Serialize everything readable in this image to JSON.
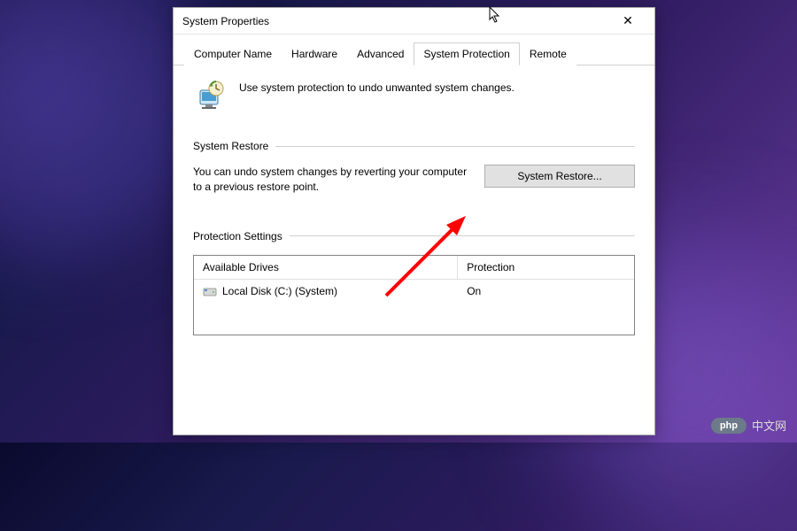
{
  "dialog": {
    "title": "System Properties",
    "close_label": "✕"
  },
  "tabs": {
    "items": [
      {
        "label": "Computer Name"
      },
      {
        "label": "Hardware"
      },
      {
        "label": "Advanced"
      },
      {
        "label": "System Protection"
      },
      {
        "label": "Remote"
      }
    ],
    "active_index": 3
  },
  "intro": {
    "text": "Use system protection to undo unwanted system changes."
  },
  "restore": {
    "section_label": "System Restore",
    "description": "You can undo system changes by reverting your computer to a previous restore point.",
    "button_label": "System Restore..."
  },
  "protection": {
    "section_label": "Protection Settings",
    "columns": {
      "drive": "Available Drives",
      "protection": "Protection"
    },
    "rows": [
      {
        "drive": "Local Disk (C:) (System)",
        "protection": "On"
      }
    ]
  },
  "watermark": {
    "pill": "php",
    "text": "中文网"
  }
}
